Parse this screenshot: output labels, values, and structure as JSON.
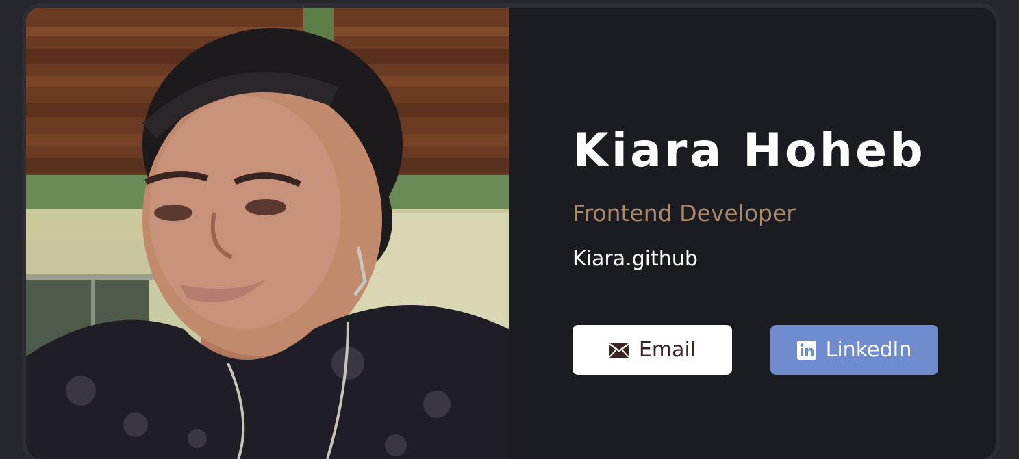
{
  "profile": {
    "name": "Kiara Hoheb",
    "role": "Frontend Developer",
    "github": "Kiara.github"
  },
  "buttons": {
    "email_label": "Email",
    "email_icon": "envelope-icon",
    "linkedin_label": "LinkedIn",
    "linkedin_icon": "linkedin-icon"
  },
  "photo": {
    "alt": "portrait photo"
  },
  "colors": {
    "page_bg": "#26272c",
    "card_bg": "#1b1c21",
    "role_text": "#ab8a6d",
    "email_button_bg": "#ffffff",
    "linkedin_button_bg": "#6f8cce"
  }
}
